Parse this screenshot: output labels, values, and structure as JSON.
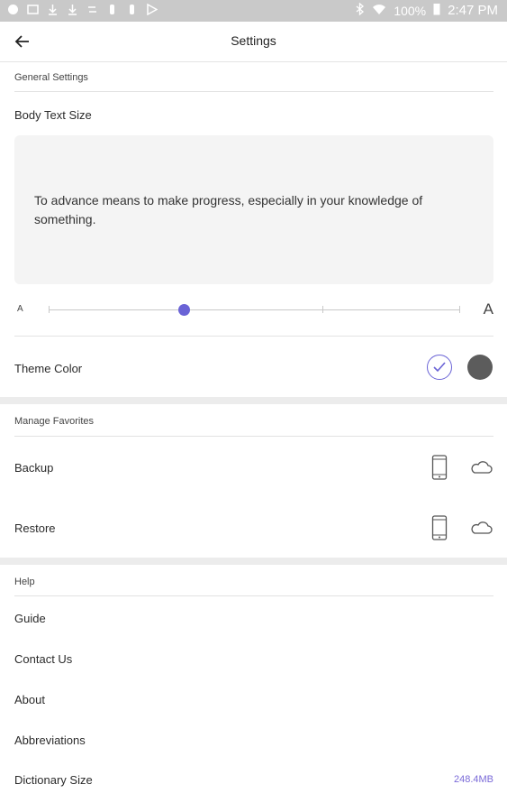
{
  "status_bar": {
    "battery": "100%",
    "time": "2:47 PM"
  },
  "header": {
    "title": "Settings"
  },
  "general": {
    "label": "General Settings",
    "body_text_size_label": "Body Text Size",
    "preview_text": "To advance means to make progress, especially in your knowledge of something.",
    "slider_min_label": "A",
    "slider_max_label": "A",
    "slider_level": 0.33,
    "theme_color_label": "Theme Color",
    "theme_colors": [
      {
        "name": "light",
        "selected": true,
        "color": "#6a63d6"
      },
      {
        "name": "dark",
        "selected": false,
        "color": "#5c5c5c"
      }
    ]
  },
  "favorites": {
    "label": "Manage Favorites",
    "backup_label": "Backup",
    "restore_label": "Restore"
  },
  "help": {
    "label": "Help",
    "items": [
      "Guide",
      "Contact Us",
      "About",
      "Abbreviations",
      "Dictionary Size"
    ],
    "dictionary_size": "248.4MB"
  },
  "colors": {
    "accent": "#6a63d6",
    "divider": "#e2e2e2",
    "preview_bg": "#f4f4f4"
  }
}
